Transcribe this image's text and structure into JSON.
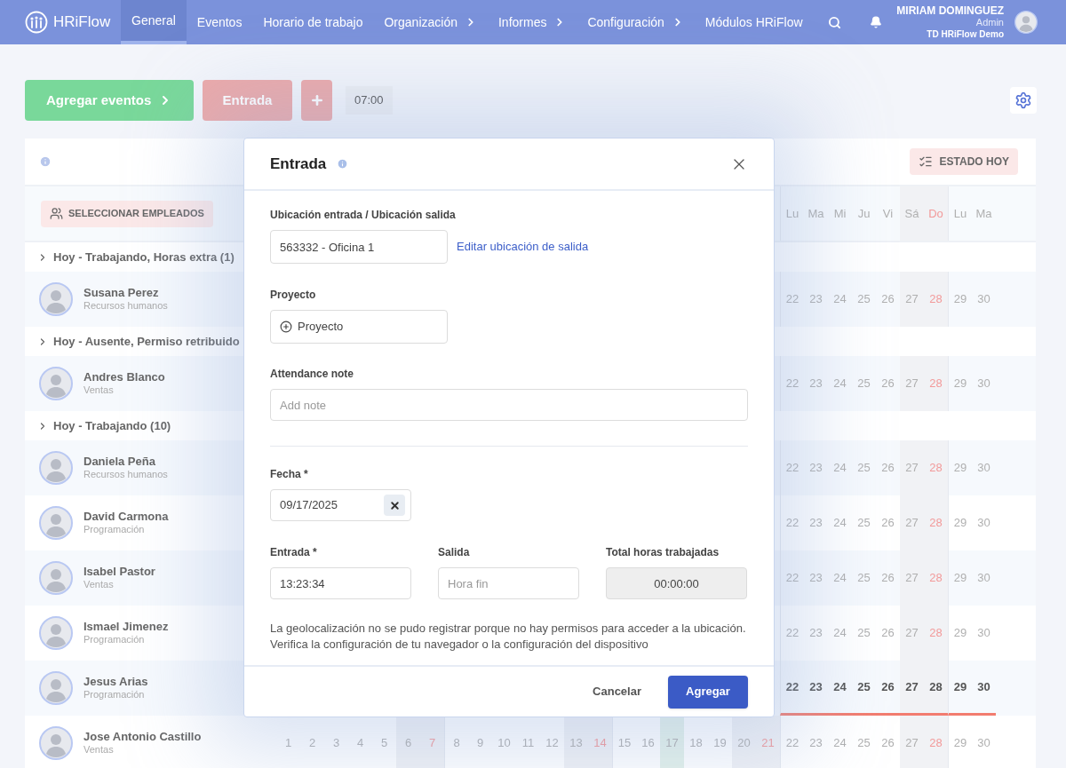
{
  "nav": {
    "logo": "HRiFlow",
    "items": [
      {
        "label": "General",
        "selected": true,
        "submenu": false
      },
      {
        "label": "Eventos",
        "selected": false,
        "submenu": false
      },
      {
        "label": "Horario de trabajo",
        "selected": false,
        "submenu": false
      },
      {
        "label": "Organización",
        "selected": false,
        "submenu": true
      },
      {
        "label": "Informes",
        "selected": false,
        "submenu": true
      },
      {
        "label": "Configuración",
        "selected": false,
        "submenu": true
      },
      {
        "label": "Módulos HRiFlow",
        "selected": false,
        "submenu": false
      }
    ],
    "user": {
      "name": "MIRIAM DOMINGUEZ",
      "role": "Admin",
      "company": "TD HRiFlow Demo"
    }
  },
  "toolbar": {
    "add_button": "Agregar eventos",
    "entry_button": "Entrada",
    "time": "07:00"
  },
  "schedule": {
    "status_button": "ESTADO HOY",
    "select_button": "SELECCIONAR EMPLEADOS",
    "weekdays": [
      {
        "label": "Lu",
        "kind": "weekday"
      },
      {
        "label": "Ma",
        "kind": "weekday"
      },
      {
        "label": "Mi",
        "kind": "weekday"
      },
      {
        "label": "Ju",
        "kind": "weekday"
      },
      {
        "label": "Vi",
        "kind": "weekday"
      },
      {
        "label": "Sá",
        "kind": "saturday"
      },
      {
        "label": "Do",
        "kind": "sunday"
      },
      {
        "label": "Lu",
        "kind": "weekday"
      },
      {
        "label": "Ma",
        "kind": "weekday"
      }
    ],
    "groups": [
      {
        "title": "Hoy - Trabajando, Horas extra (1)",
        "employees": [
          {
            "name": "Susana Perez",
            "department": "Recursos humanos",
            "highlighted": false,
            "days": [
              {
                "label": "22",
                "kind": "weekday"
              },
              {
                "label": "23",
                "kind": "weekday"
              },
              {
                "label": "24",
                "kind": "weekday"
              },
              {
                "label": "25",
                "kind": "weekday"
              },
              {
                "label": "26",
                "kind": "weekday"
              },
              {
                "label": "27",
                "kind": "saturday"
              },
              {
                "label": "28",
                "kind": "sunday"
              },
              {
                "label": "29",
                "kind": "weekday"
              },
              {
                "label": "30",
                "kind": "weekday"
              }
            ]
          }
        ]
      },
      {
        "title": "Hoy - Ausente, Permiso retribuido",
        "employees": [
          {
            "name": "Andres Blanco",
            "department": "Ventas",
            "highlighted": false,
            "days": [
              {
                "label": "22",
                "kind": "weekday"
              },
              {
                "label": "23",
                "kind": "weekday"
              },
              {
                "label": "24",
                "kind": "weekday"
              },
              {
                "label": "25",
                "kind": "weekday"
              },
              {
                "label": "26",
                "kind": "weekday"
              },
              {
                "label": "27",
                "kind": "saturday"
              },
              {
                "label": "28",
                "kind": "sunday"
              },
              {
                "label": "29",
                "kind": "weekday"
              },
              {
                "label": "30",
                "kind": "weekday"
              }
            ]
          }
        ]
      },
      {
        "title": "Hoy - Trabajando (10)",
        "employees": [
          {
            "name": "Daniela Peña",
            "department": "Recursos humanos",
            "highlighted": false,
            "days": [
              {
                "label": "22",
                "kind": "weekday"
              },
              {
                "label": "23",
                "kind": "weekday"
              },
              {
                "label": "24",
                "kind": "weekday"
              },
              {
                "label": "25",
                "kind": "weekday"
              },
              {
                "label": "26",
                "kind": "weekday"
              },
              {
                "label": "27",
                "kind": "saturday"
              },
              {
                "label": "28",
                "kind": "sunday"
              },
              {
                "label": "29",
                "kind": "weekday"
              },
              {
                "label": "30",
                "kind": "weekday"
              }
            ]
          },
          {
            "name": "David Carmona",
            "department": "Programación",
            "highlighted": false,
            "days": [
              {
                "label": "22",
                "kind": "weekday"
              },
              {
                "label": "23",
                "kind": "weekday"
              },
              {
                "label": "24",
                "kind": "weekday"
              },
              {
                "label": "25",
                "kind": "weekday"
              },
              {
                "label": "26",
                "kind": "weekday"
              },
              {
                "label": "27",
                "kind": "saturday"
              },
              {
                "label": "28",
                "kind": "sunday"
              },
              {
                "label": "29",
                "kind": "weekday"
              },
              {
                "label": "30",
                "kind": "weekday"
              }
            ]
          },
          {
            "name": "Isabel Pastor",
            "department": "Ventas",
            "highlighted": false,
            "days": [
              {
                "label": "22",
                "kind": "weekday"
              },
              {
                "label": "23",
                "kind": "weekday"
              },
              {
                "label": "24",
                "kind": "weekday"
              },
              {
                "label": "25",
                "kind": "weekday"
              },
              {
                "label": "26",
                "kind": "weekday"
              },
              {
                "label": "27",
                "kind": "saturday"
              },
              {
                "label": "28",
                "kind": "sunday"
              },
              {
                "label": "29",
                "kind": "weekday"
              },
              {
                "label": "30",
                "kind": "weekday"
              }
            ]
          },
          {
            "name": "Ismael Jimenez",
            "department": "Programación",
            "highlighted": false,
            "days": [
              {
                "label": "22",
                "kind": "weekday"
              },
              {
                "label": "23",
                "kind": "weekday"
              },
              {
                "label": "24",
                "kind": "weekday"
              },
              {
                "label": "25",
                "kind": "weekday"
              },
              {
                "label": "26",
                "kind": "weekday"
              },
              {
                "label": "27",
                "kind": "saturday"
              },
              {
                "label": "28",
                "kind": "sunday"
              },
              {
                "label": "29",
                "kind": "weekday"
              },
              {
                "label": "30",
                "kind": "weekday"
              }
            ]
          },
          {
            "name": "Jesus Arias",
            "department": "Programación",
            "highlighted": true,
            "days": [
              {
                "label": "22",
                "kind": "weekday"
              },
              {
                "label": "23",
                "kind": "weekday"
              },
              {
                "label": "24",
                "kind": "weekday"
              },
              {
                "label": "25",
                "kind": "weekday"
              },
              {
                "label": "26",
                "kind": "weekday"
              },
              {
                "label": "27",
                "kind": "saturday"
              },
              {
                "label": "28",
                "kind": "sunday"
              },
              {
                "label": "29",
                "kind": "weekday"
              },
              {
                "label": "30",
                "kind": "weekday"
              }
            ]
          },
          {
            "name": "Jose Antonio Castillo",
            "department": "Ventas",
            "highlighted": false,
            "days": [
              {
                "label": "1",
                "kind": "weekday"
              },
              {
                "label": "2",
                "kind": "weekday"
              },
              {
                "label": "3",
                "kind": "weekday"
              },
              {
                "label": "4",
                "kind": "weekday"
              },
              {
                "label": "5",
                "kind": "weekday"
              },
              {
                "label": "6",
                "kind": "saturday"
              },
              {
                "label": "7",
                "kind": "sunday"
              },
              {
                "label": "8",
                "kind": "weekday"
              },
              {
                "label": "9",
                "kind": "weekday"
              },
              {
                "label": "10",
                "kind": "weekday"
              },
              {
                "label": "11",
                "kind": "weekday"
              },
              {
                "label": "12",
                "kind": "weekday"
              },
              {
                "label": "13",
                "kind": "saturday"
              },
              {
                "label": "14",
                "kind": "sunday"
              },
              {
                "label": "15",
                "kind": "weekday"
              },
              {
                "label": "16",
                "kind": "weekday"
              },
              {
                "label": "17",
                "kind": "today"
              },
              {
                "label": "18",
                "kind": "weekday"
              },
              {
                "label": "19",
                "kind": "weekday"
              },
              {
                "label": "20",
                "kind": "saturday"
              },
              {
                "label": "21",
                "kind": "sunday"
              },
              {
                "label": "22",
                "kind": "weekday"
              },
              {
                "label": "23",
                "kind": "weekday"
              },
              {
                "label": "24",
                "kind": "weekday"
              },
              {
                "label": "25",
                "kind": "weekday"
              },
              {
                "label": "26",
                "kind": "weekday"
              },
              {
                "label": "27",
                "kind": "saturday"
              },
              {
                "label": "28",
                "kind": "sunday"
              },
              {
                "label": "29",
                "kind": "weekday"
              },
              {
                "label": "30",
                "kind": "weekday"
              }
            ]
          }
        ]
      }
    ]
  },
  "dialog": {
    "title": "Entrada",
    "location": {
      "label": "Ubicación entrada / Ubicación salida",
      "value": "563332 - Oficina 1",
      "link": "Editar ubicación de salida"
    },
    "project": {
      "label": "Proyecto",
      "button": "Proyecto"
    },
    "note": {
      "label": "Attendance note",
      "placeholder": "Add note"
    },
    "date": {
      "label": "Fecha *",
      "value": "09/17/2025"
    },
    "times": [
      {
        "label": "Entrada *",
        "value": "13:23:34",
        "disabled": false
      },
      {
        "label": "Salida",
        "placeholder": "Hora fin",
        "disabled": false
      },
      {
        "label": "Total horas trabajadas",
        "value": "00:00:00",
        "disabled": true
      }
    ],
    "message": "La geolocalización no se pudo registrar porque no hay permisos para acceder a la ubicación. Verifica la configuración de tu navegador o la configuración del dispositivo",
    "cancel": "Cancelar",
    "submit": "Agregar"
  }
}
